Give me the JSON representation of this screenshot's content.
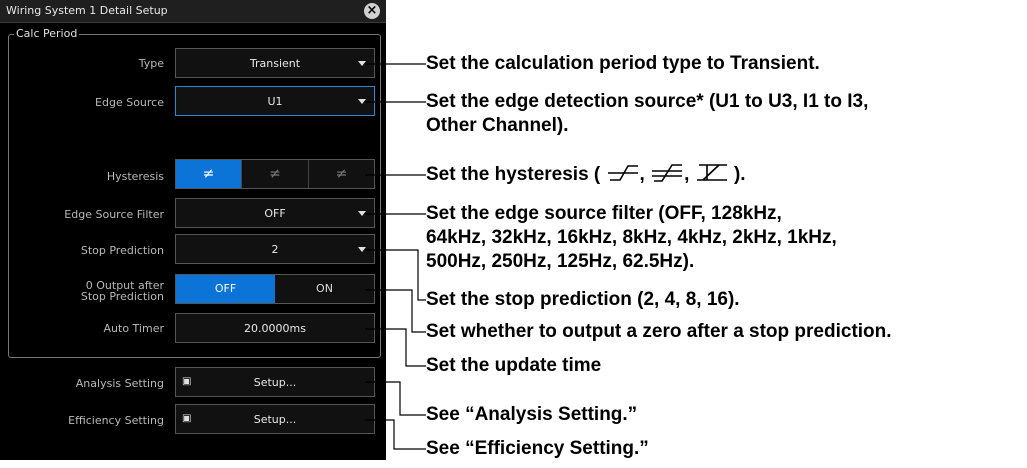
{
  "dialog": {
    "title": "Wiring System 1 Detail Setup",
    "close_icon": "close-icon",
    "group_label": "Calc Period"
  },
  "fields": {
    "type": {
      "label": "Type",
      "value": "Transient"
    },
    "edge_source": {
      "label": "Edge Source",
      "value": "U1"
    },
    "hysteresis": {
      "label": "Hysteresis",
      "options": [
        "≠",
        "≠",
        "≠"
      ],
      "selected_index": 0
    },
    "edge_source_filter": {
      "label": "Edge Source Filter",
      "value": "OFF"
    },
    "stop_prediction": {
      "label": "Stop Prediction",
      "value": "2"
    },
    "zero_output": {
      "label_line1": "0 Output after",
      "label_line2": "Stop Prediction",
      "options": [
        "OFF",
        "ON"
      ],
      "selected_index": 0
    },
    "auto_timer": {
      "label": "Auto Timer",
      "value": "20.0000ms"
    },
    "analysis_setting": {
      "label": "Analysis Setting",
      "button": "Setup..."
    },
    "efficiency_setting": {
      "label": "Efficiency Setting",
      "button": "Setup..."
    }
  },
  "annotations": {
    "type": "Set the calculation period type to Transient.",
    "edge_source_1": "Set the edge detection source* (U1 to U3, I1 to I3,",
    "edge_source_2": "Other Channel).",
    "hysteresis_prefix": "Set the hysteresis (",
    "hysteresis_suffix": ").",
    "filter_1": "Set the edge source filter (OFF, 128kHz,",
    "filter_2": "64kHz, 32kHz, 16kHz, 8kHz, 4kHz, 2kHz, 1kHz,",
    "filter_3": "500Hz, 250Hz, 125Hz, 62.5Hz).",
    "stop_prediction": "Set the stop prediction (2, 4, 8, 16).",
    "zero_output": "Set whether to output a zero after a stop prediction.",
    "auto_timer": "Set the update time",
    "analysis": "See “Analysis Setting.”",
    "efficiency": "See “Efficiency Setting.”"
  }
}
